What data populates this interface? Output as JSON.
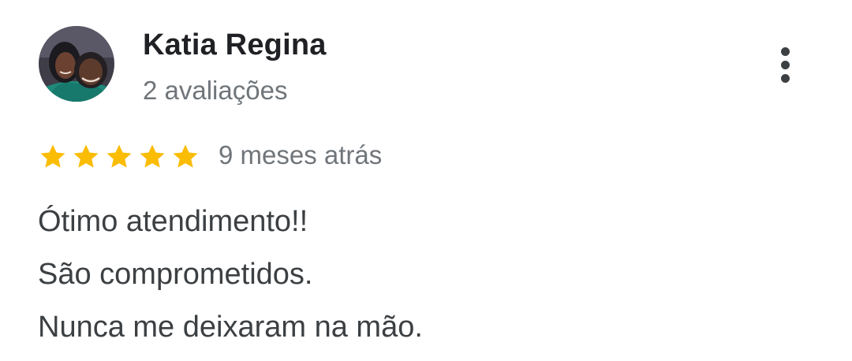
{
  "reviewer": {
    "name": "Katia Regina",
    "review_count": "2 avaliações",
    "avatar_icon": "profile-photo"
  },
  "menu": {
    "icon": "more-vert-icon"
  },
  "rating": {
    "stars": 5,
    "max_stars": 5,
    "star_color": "#fbbc04",
    "time_ago": "9 meses atrás"
  },
  "review": {
    "lines": [
      "Ótimo atendimento!!",
      "São comprometidos.",
      "Nunca me deixaram na mão."
    ]
  }
}
